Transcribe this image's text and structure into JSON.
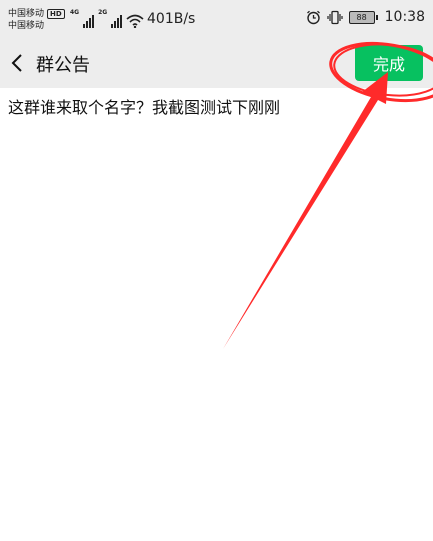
{
  "status_bar": {
    "carrier_1": "中国移动",
    "hd_badge": "HD",
    "carrier_2": "中国移动",
    "net_1": "4G",
    "net_2": "2G",
    "speed": "401B/s",
    "battery": "88",
    "time": "10:38",
    "icons": [
      "alarm-icon",
      "vibrate-icon",
      "wifi-icon",
      "signal-icon",
      "battery-icon"
    ]
  },
  "header": {
    "title": "群公告",
    "done_label": "完成",
    "back_icon": "chevron-left-icon"
  },
  "content": {
    "announcement_text": "这群谁来取个名字？我截图测试下刚刚"
  },
  "colors": {
    "accent_green": "#07c160",
    "annotation_red": "#ff2a2a",
    "bar_background": "#ededed"
  }
}
